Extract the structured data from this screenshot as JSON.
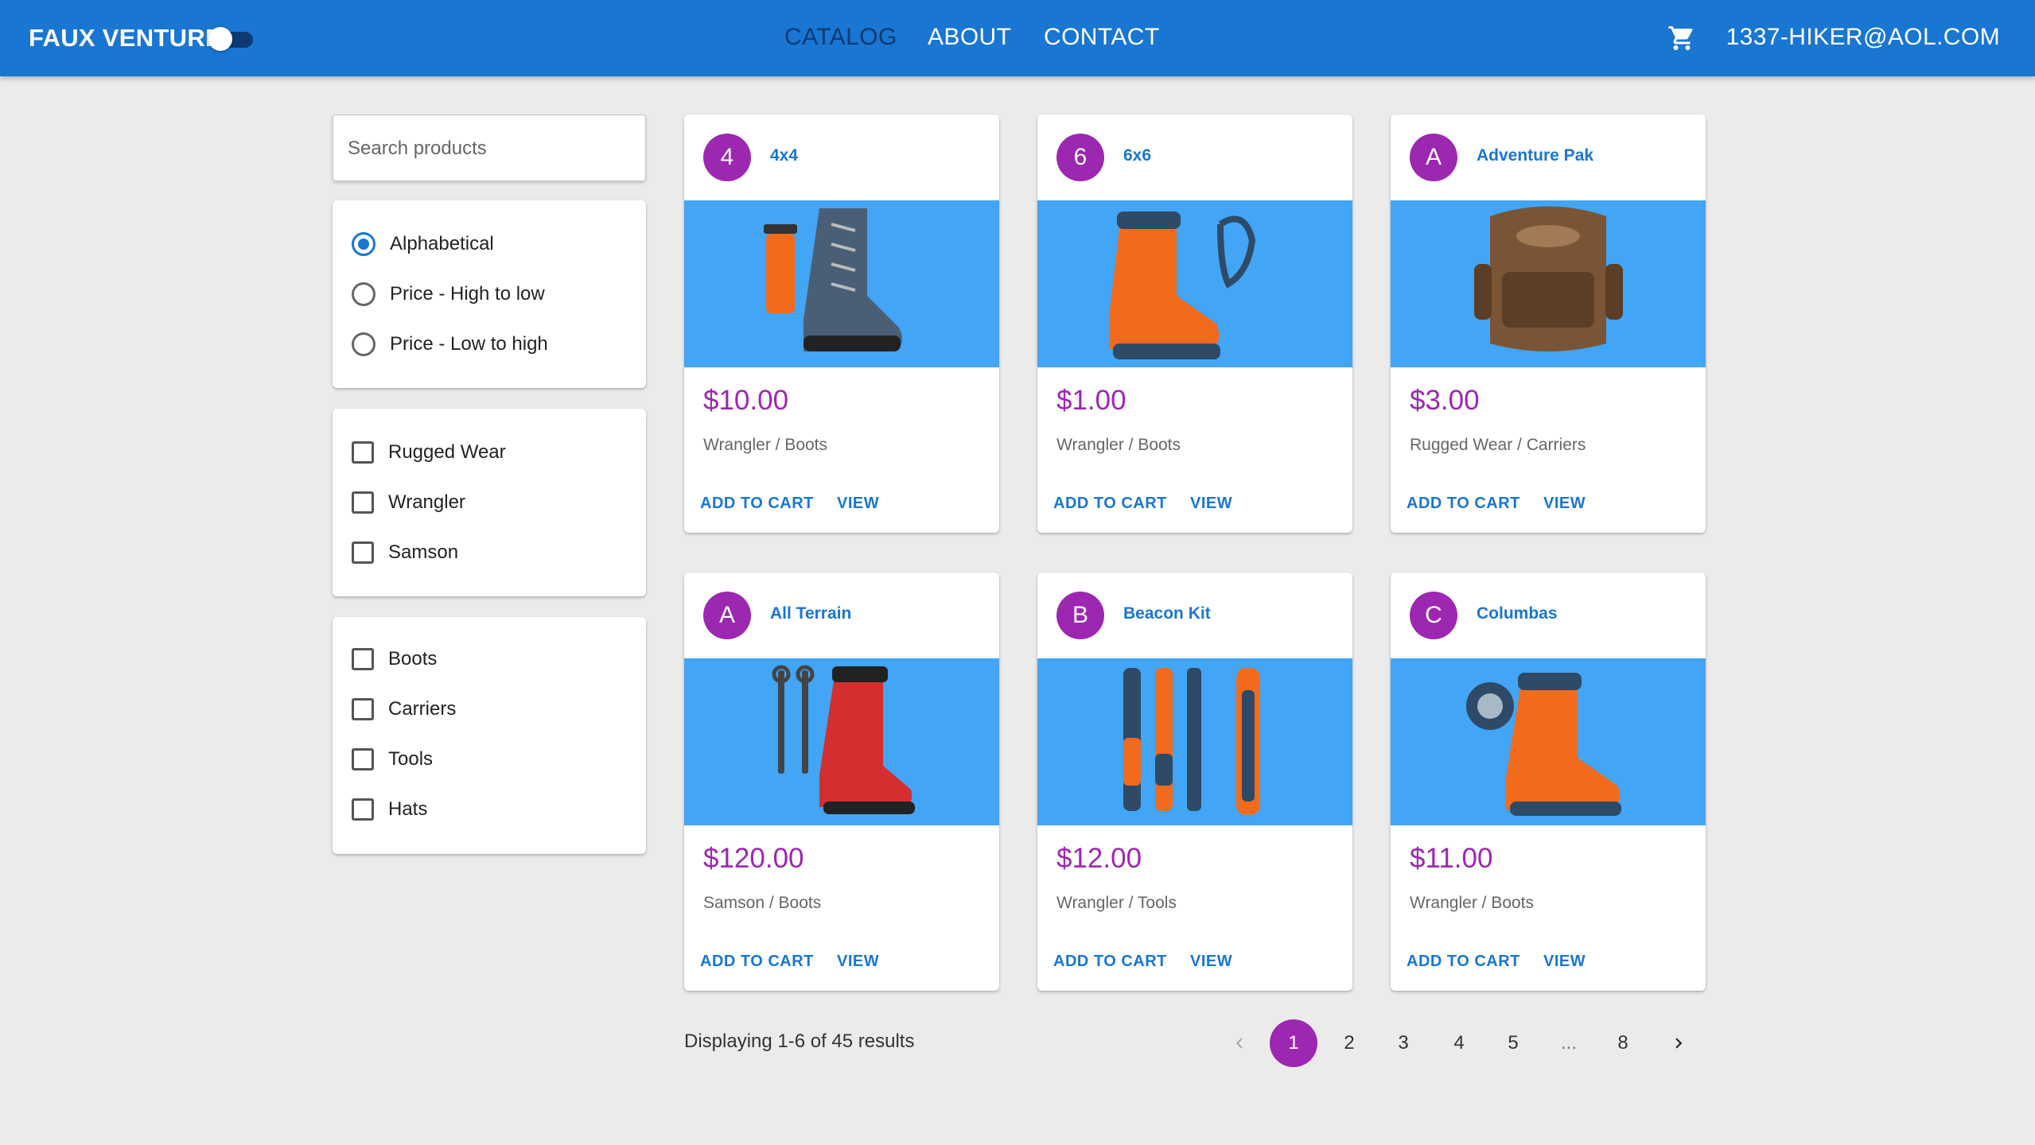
{
  "app": {
    "brand": "FAUX VENTURE",
    "nav": [
      {
        "label": "CATALOG",
        "active": true
      },
      {
        "label": "ABOUT",
        "active": false
      },
      {
        "label": "CONTACT",
        "active": false
      }
    ],
    "cart_icon": "shopping-cart-icon",
    "user_email": "1337-HIKER@AOL.COM",
    "colors": {
      "appbar": "#1976d2",
      "accent": "#9c27b0",
      "media": "#42a5f5"
    }
  },
  "filters": {
    "search_placeholder": "Search products",
    "sort": {
      "selected": "Alphabetical",
      "options": [
        "Alphabetical",
        "Price - High to low",
        "Price - Low to high"
      ]
    },
    "brands": [
      "Rugged Wear",
      "Wrangler",
      "Samson"
    ],
    "categories": [
      "Boots",
      "Carriers",
      "Tools",
      "Hats"
    ]
  },
  "products": [
    {
      "initial": "4",
      "name": "4x4",
      "price": "$10.00",
      "meta": "Wrangler / Boots",
      "image": "boot-and-thermos-image"
    },
    {
      "initial": "6",
      "name": "6x6",
      "price": "$1.00",
      "meta": "Wrangler / Boots",
      "image": "orange-boot-image"
    },
    {
      "initial": "A",
      "name": "Adventure Pak",
      "price": "$3.00",
      "meta": "Rugged Wear / Carriers",
      "image": "backpack-image"
    },
    {
      "initial": "A",
      "name": "All Terrain",
      "price": "$120.00",
      "meta": "Samson / Boots",
      "image": "red-boot-image"
    },
    {
      "initial": "B",
      "name": "Beacon Kit",
      "price": "$12.00",
      "meta": "Wrangler / Tools",
      "image": "tools-image"
    },
    {
      "initial": "C",
      "name": "Columbas",
      "price": "$11.00",
      "meta": "Wrangler / Boots",
      "image": "orange-boot-image"
    }
  ],
  "card_actions": {
    "add": "ADD TO CART",
    "view": "VIEW"
  },
  "pagination": {
    "summary": "Displaying 1-6 of 45 results",
    "pages": [
      "1",
      "2",
      "3",
      "4",
      "5",
      "...",
      "8"
    ],
    "current": "1"
  }
}
